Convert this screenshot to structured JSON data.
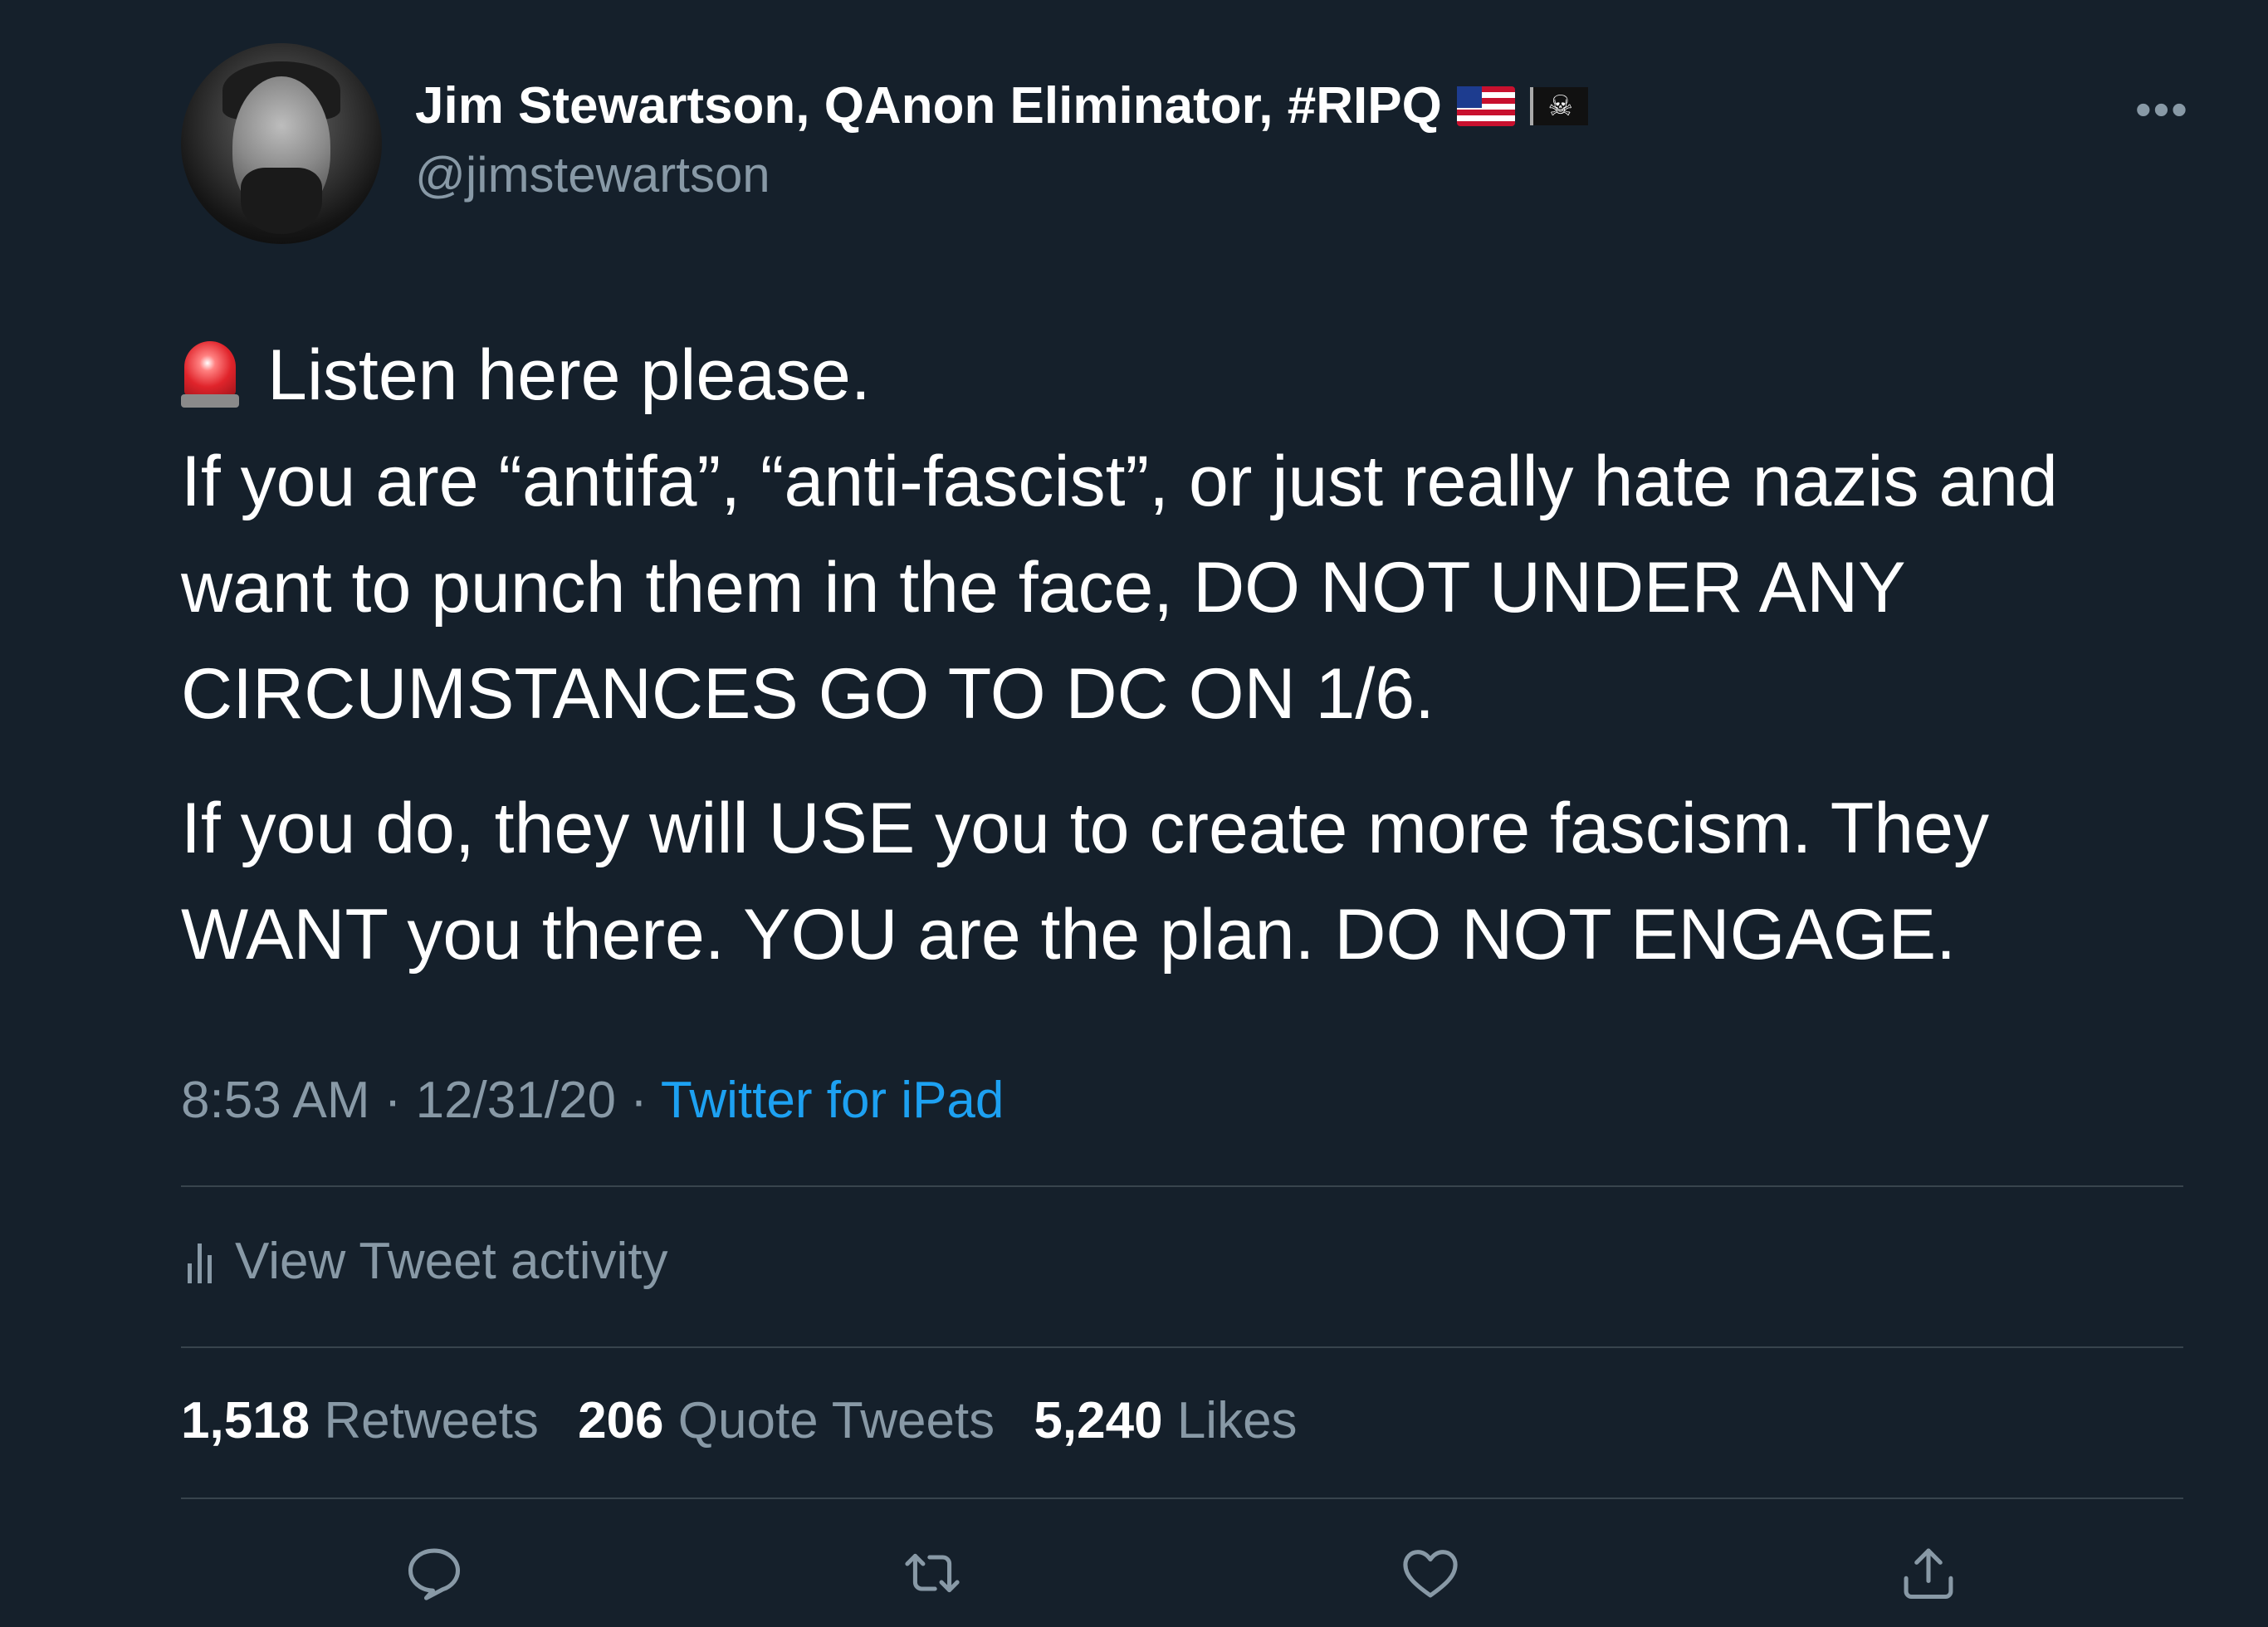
{
  "user": {
    "display_name": "Jim Stewartson, QAnon Eliminator, #RIPQ",
    "handle": "@jimstewartson",
    "name_emojis": [
      "us-flag-icon",
      "pirate-flag-icon"
    ]
  },
  "more_icon": "more-dots-icon",
  "tweet": {
    "paragraph1": "Listen here please.\nIf you are “antifa”, “anti-fascist”, or just really hate nazis and want to punch them in the face, DO NOT UNDER ANY CIRCUMSTANCES GO TO DC ON 1/6.",
    "paragraph2": "If you do, they will USE you to create more fascism. They WANT you there. YOU are the plan. DO NOT ENGAGE.",
    "leading_emoji": "siren-icon"
  },
  "meta": {
    "time": "8:53 AM",
    "sep1": " · ",
    "date": "12/31/20",
    "sep2": " · ",
    "source": "Twitter for iPad"
  },
  "activity": {
    "label": "View Tweet activity",
    "icon": "bar-chart-icon"
  },
  "stats": {
    "retweets_count": "1,518",
    "retweets_label": "Retweets",
    "quotes_count": "206",
    "quotes_label": "Quote Tweets",
    "likes_count": "5,240",
    "likes_label": "Likes"
  },
  "actions": [
    "reply-icon",
    "retweet-icon",
    "like-icon",
    "share-icon"
  ],
  "colors": {
    "background": "#15202b",
    "secondary_text": "#8899a6",
    "link": "#1da1f2",
    "divider": "#38444d"
  }
}
